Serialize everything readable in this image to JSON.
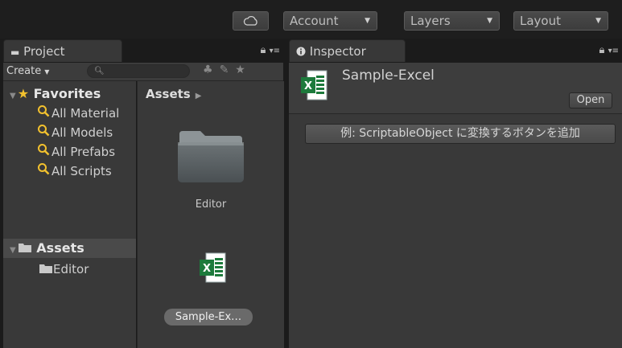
{
  "toolbar": {
    "cloud_icon": "cloud-icon",
    "account_label": "Account",
    "layers_label": "Layers",
    "layout_label": "Layout"
  },
  "project": {
    "tab_label": "Project",
    "create_label": "Create",
    "favorites_label": "Favorites",
    "favorites": [
      "All Material",
      "All Models",
      "All Prefabs",
      "All Scripts"
    ],
    "assets_label": "Assets",
    "tree_children": [
      "Editor"
    ],
    "breadcrumb": "Assets",
    "grid_items": [
      {
        "label": "Editor",
        "icon": "folder-icon"
      },
      {
        "label": "Sample-Ex…",
        "icon": "excel-file-icon",
        "selected": true
      }
    ]
  },
  "inspector": {
    "tab_label": "Inspector",
    "asset_name": "Sample-Excel",
    "open_label": "Open",
    "action_label": "例: ScriptableObject に変換するボタンを追加"
  },
  "colors": {
    "background": "#1b1b1b",
    "panel": "#393939",
    "selection": "#4a4a4a",
    "star": "#f2c12e",
    "excel_green": "#1d7a3c"
  }
}
